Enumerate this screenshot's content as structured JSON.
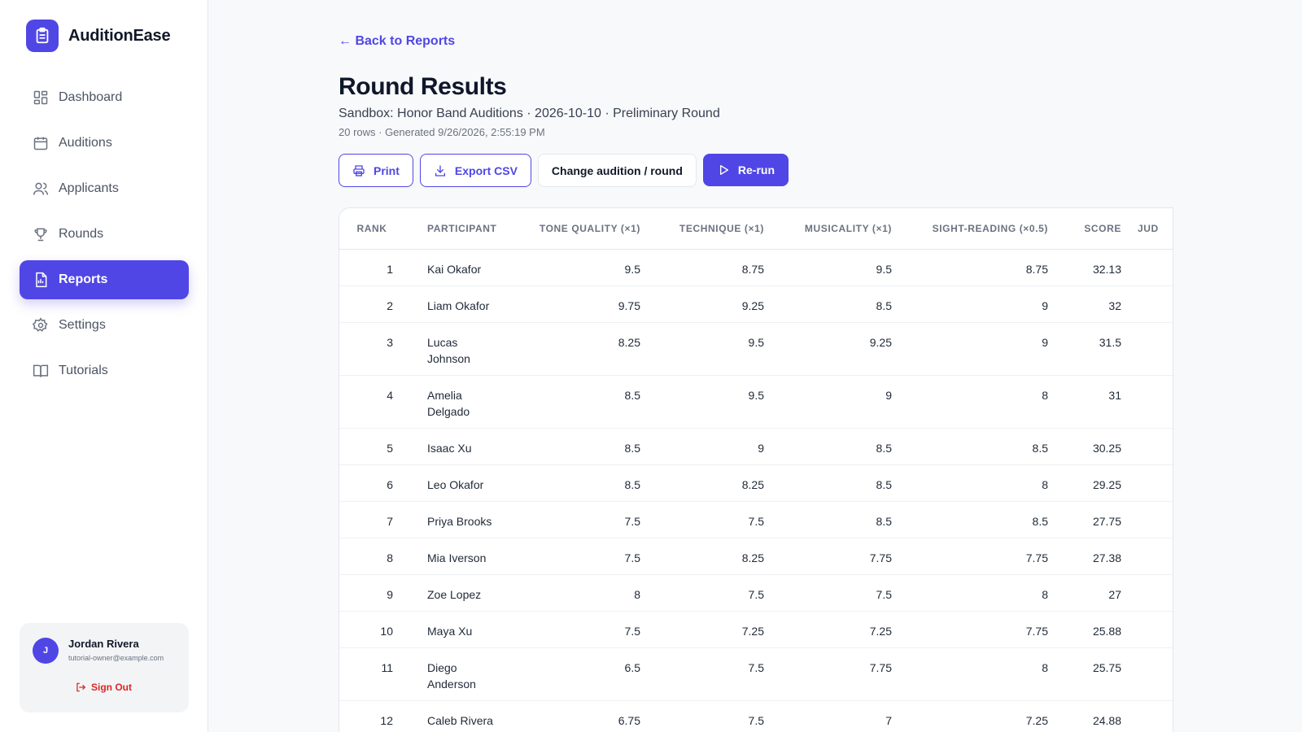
{
  "app": {
    "name": "AuditionEase",
    "brand_color": "#5046e5"
  },
  "sidebar": {
    "items": [
      {
        "label": "Dashboard",
        "icon": "grid-icon"
      },
      {
        "label": "Auditions",
        "icon": "calendar-icon"
      },
      {
        "label": "Applicants",
        "icon": "users-icon"
      },
      {
        "label": "Rounds",
        "icon": "trophy-icon"
      },
      {
        "label": "Reports",
        "icon": "report-icon",
        "active": true
      },
      {
        "label": "Settings",
        "icon": "gear-icon"
      },
      {
        "label": "Tutorials",
        "icon": "book-icon"
      }
    ],
    "user": {
      "initial": "J",
      "name": "Jordan Rivera",
      "email": "tutorial-owner@example.com",
      "signout_label": "Sign Out"
    }
  },
  "page": {
    "back_link": "← Back to Reports",
    "title": "Round Results",
    "subtitle": "Sandbox: Honor Band Auditions · 2026-10-10 · Preliminary Round",
    "meta": "20 rows · Generated 9/26/2026, 2:55:19 PM",
    "actions": {
      "print": "Print",
      "export": "Export CSV",
      "change": "Change audition / round",
      "rerun": "Re-run"
    }
  },
  "table": {
    "headers": {
      "rank": "Rank",
      "participant": "Participant",
      "tone": "Tone Quality (×1)",
      "technique": "Technique (×1)",
      "musicality": "Musicality (×1)",
      "sight": "Sight-Reading (×0.5)",
      "score": "Score",
      "judges": "Jud"
    },
    "rows": [
      {
        "rank": "1",
        "participant": "Kai Okafor",
        "tone": "9.5",
        "technique": "8.75",
        "musicality": "9.5",
        "sight": "8.75",
        "score": "32.13"
      },
      {
        "rank": "2",
        "participant": "Liam Okafor",
        "tone": "9.75",
        "technique": "9.25",
        "musicality": "8.5",
        "sight": "9",
        "score": "32"
      },
      {
        "rank": "3",
        "participant": "Lucas Johnson",
        "tone": "8.25",
        "technique": "9.5",
        "musicality": "9.25",
        "sight": "9",
        "score": "31.5"
      },
      {
        "rank": "4",
        "participant": "Amelia Delgado",
        "tone": "8.5",
        "technique": "9.5",
        "musicality": "9",
        "sight": "8",
        "score": "31"
      },
      {
        "rank": "5",
        "participant": "Isaac Xu",
        "tone": "8.5",
        "technique": "9",
        "musicality": "8.5",
        "sight": "8.5",
        "score": "30.25"
      },
      {
        "rank": "6",
        "participant": "Leo Okafor",
        "tone": "8.5",
        "technique": "8.25",
        "musicality": "8.5",
        "sight": "8",
        "score": "29.25"
      },
      {
        "rank": "7",
        "participant": "Priya Brooks",
        "tone": "7.5",
        "technique": "7.5",
        "musicality": "8.5",
        "sight": "8.5",
        "score": "27.75"
      },
      {
        "rank": "8",
        "participant": "Mia Iverson",
        "tone": "7.5",
        "technique": "8.25",
        "musicality": "7.75",
        "sight": "7.75",
        "score": "27.38"
      },
      {
        "rank": "9",
        "participant": "Zoe Lopez",
        "tone": "8",
        "technique": "7.5",
        "musicality": "7.5",
        "sight": "8",
        "score": "27"
      },
      {
        "rank": "10",
        "participant": "Maya Xu",
        "tone": "7.5",
        "technique": "7.25",
        "musicality": "7.25",
        "sight": "7.75",
        "score": "25.88"
      },
      {
        "rank": "11",
        "participant": "Diego Anderson",
        "tone": "6.5",
        "technique": "7.5",
        "musicality": "7.75",
        "sight": "8",
        "score": "25.75"
      },
      {
        "rank": "12",
        "participant": "Caleb Rivera",
        "tone": "6.75",
        "technique": "7.5",
        "musicality": "7",
        "sight": "7.25",
        "score": "24.88"
      }
    ]
  }
}
